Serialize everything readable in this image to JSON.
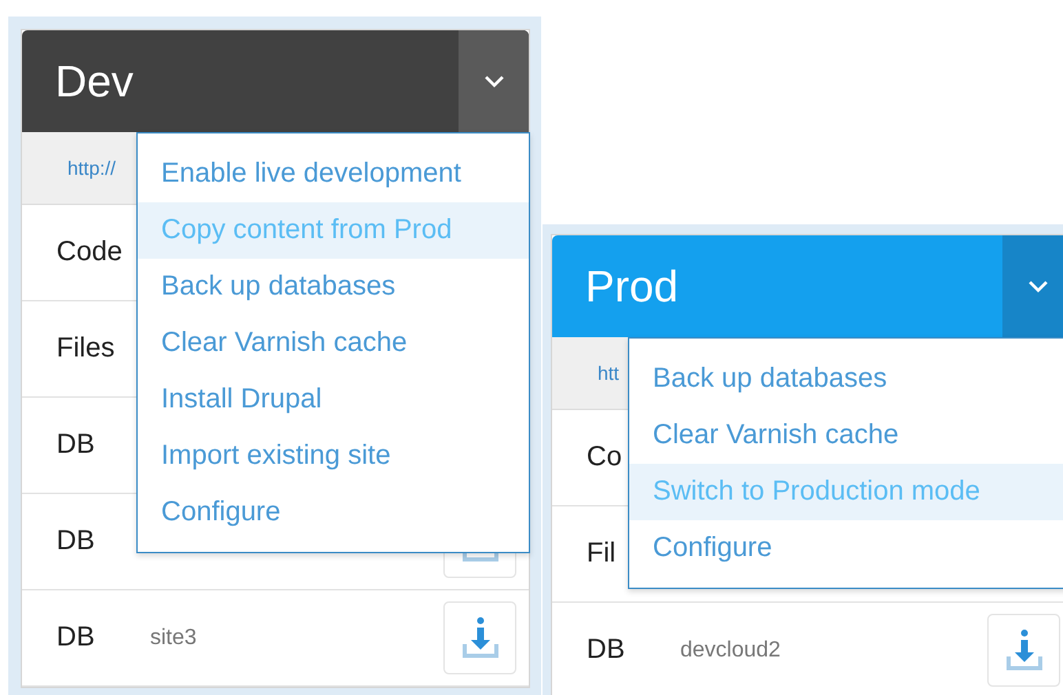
{
  "panels": [
    {
      "title": "Dev",
      "kind": "dark",
      "url": "http://",
      "rows": [
        {
          "label": "Code"
        },
        {
          "label": "Files"
        },
        {
          "label": "DB"
        },
        {
          "label": "DB",
          "download": true
        },
        {
          "label": "DB",
          "value": "site3",
          "download": true
        }
      ],
      "menu": [
        {
          "label": "Enable live development",
          "selected": false
        },
        {
          "label": "Copy content from Prod",
          "selected": true
        },
        {
          "label": "Back up databases",
          "selected": false
        },
        {
          "label": "Clear Varnish cache",
          "selected": false
        },
        {
          "label": "Install Drupal",
          "selected": false
        },
        {
          "label": "Import existing site",
          "selected": false
        },
        {
          "label": "Configure",
          "selected": false
        }
      ]
    },
    {
      "title": "Prod",
      "kind": "blue",
      "url": "htt",
      "rows": [
        {
          "label": "Co"
        },
        {
          "label": "Fil"
        },
        {
          "label": "DB",
          "value": "devcloud2",
          "download": true
        }
      ],
      "menu": [
        {
          "label": "Back up databases",
          "selected": false
        },
        {
          "label": "Clear Varnish cache",
          "selected": false
        },
        {
          "label": "Switch to Production mode",
          "selected": true
        },
        {
          "label": "Configure",
          "selected": false
        }
      ]
    }
  ]
}
